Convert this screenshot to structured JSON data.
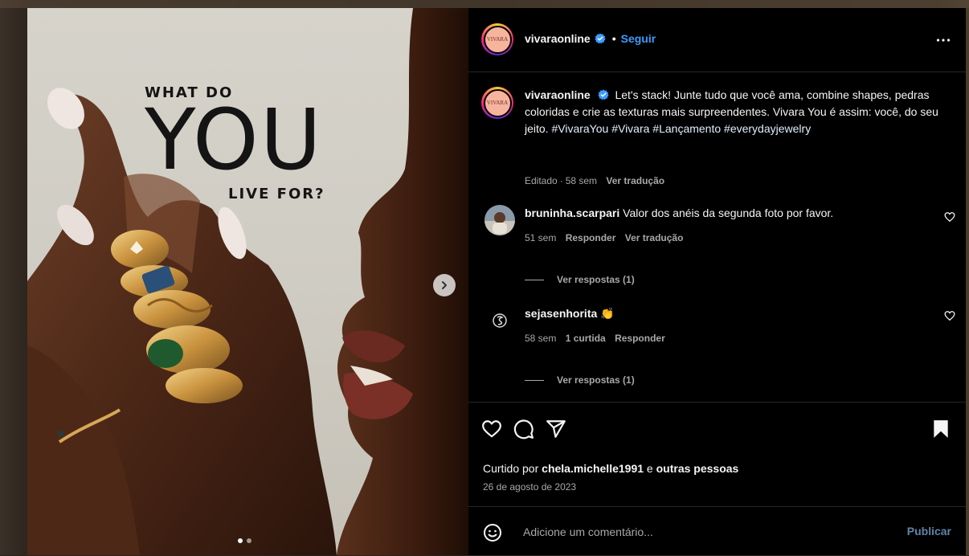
{
  "ad": {
    "line1": "WHAT DO",
    "line2": "YOU",
    "line3": "LIVE FOR?"
  },
  "header": {
    "avatar_text": "VIVARA",
    "username": "vivaraonline",
    "separator": "•",
    "follow_label": "Seguir"
  },
  "caption": {
    "avatar_text": "VIVARA",
    "username": "vivaraonline",
    "text": "Let's stack! Junte tudo que você ama, combine shapes, pedras coloridas e crie as texturas mais surpreendentes. Vivara You é assim: você, do seu jeito.",
    "hashtags": "#VivaraYou #Vivara #Lançamento #everydayjewelry",
    "edited": "Editado",
    "dot": "·",
    "age": "58 sem",
    "translate": "Ver tradução"
  },
  "comments": [
    {
      "username": "bruninha.scarpari",
      "text": "Valor dos anéis da segunda foto por favor.",
      "age": "51 sem",
      "reply": "Responder",
      "translate": "Ver tradução",
      "view_replies": "Ver respostas (1)"
    },
    {
      "username": "sejasenhorita",
      "text": "👏",
      "age": "58 sem",
      "likes": "1 curtida",
      "reply": "Responder",
      "view_replies": "Ver respostas (1)"
    }
  ],
  "likes": {
    "prefix": "Curtido por",
    "user": "chela.michelle1991",
    "connector": "e",
    "others": "outras pessoas"
  },
  "date": "26 de agosto de 2023",
  "add_comment": {
    "placeholder": "Adicione um comentário...",
    "publish_label": "Publicar"
  },
  "colors": {
    "link_blue": "#3b9cff",
    "publish_blue": "#5f84a8",
    "avatar_bg": "#f6b49d"
  }
}
